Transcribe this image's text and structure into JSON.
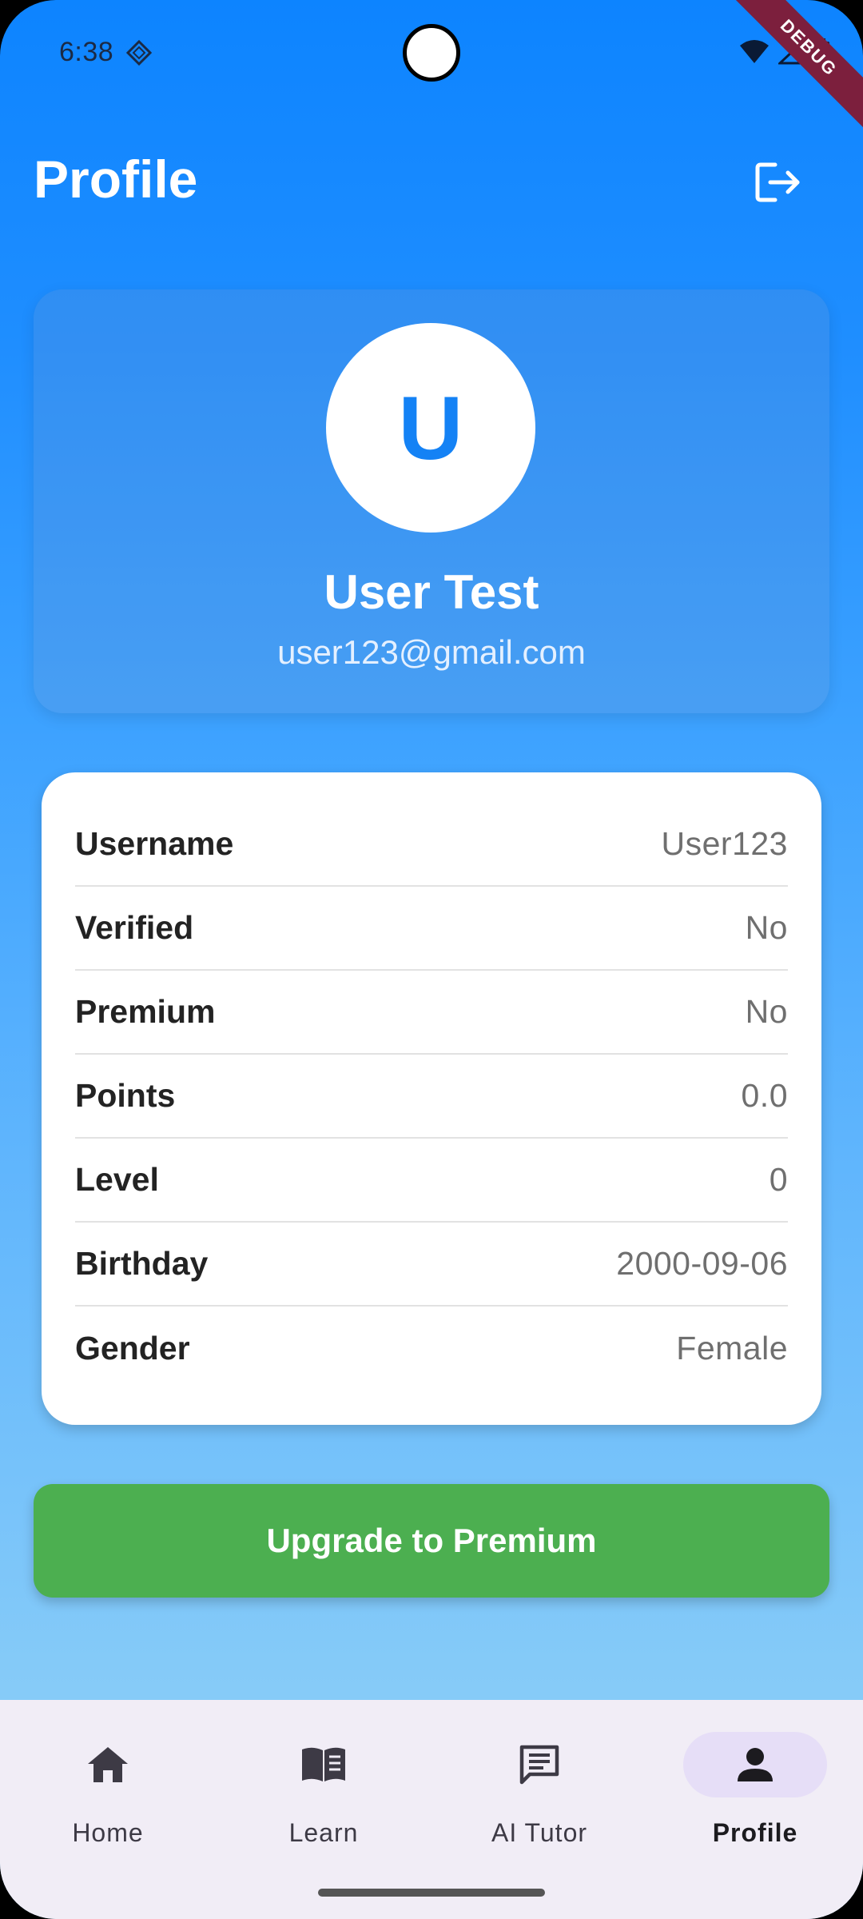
{
  "status_bar": {
    "time": "6:38",
    "debug_label": "DEBUG"
  },
  "header": {
    "title": "Profile"
  },
  "profile": {
    "avatar_initial": "U",
    "name": "User Test",
    "email": "user123@gmail.com"
  },
  "info": {
    "rows": [
      {
        "label": "Username",
        "value": "User123"
      },
      {
        "label": "Verified",
        "value": "No"
      },
      {
        "label": "Premium",
        "value": "No"
      },
      {
        "label": "Points",
        "value": "0.0"
      },
      {
        "label": "Level",
        "value": "0"
      },
      {
        "label": "Birthday",
        "value": "2000-09-06"
      },
      {
        "label": "Gender",
        "value": "Female"
      }
    ]
  },
  "actions": {
    "upgrade_label": "Upgrade to Premium"
  },
  "nav": {
    "items": [
      {
        "label": "Home",
        "icon": "home-icon"
      },
      {
        "label": "Learn",
        "icon": "book-icon"
      },
      {
        "label": "AI Tutor",
        "icon": "chat-icon"
      },
      {
        "label": "Profile",
        "icon": "person-icon",
        "active": true
      }
    ]
  },
  "colors": {
    "primary_blue": "#1482F5",
    "upgrade_green": "#4CAF50",
    "nav_active": "#E6DEF7"
  }
}
